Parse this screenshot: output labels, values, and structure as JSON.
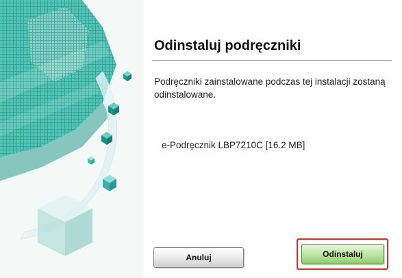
{
  "dialog": {
    "title": "Odinstaluj podręczniki",
    "description": "Podręczniki zainstalowane podczas tej instalacji zostaną odinstalowane.",
    "manual_item": "e-Podręcznik LBP7210C [16.2 MB]",
    "cancel_label": "Anuluj",
    "uninstall_label": "Odinstaluj"
  },
  "banner": {
    "image": "canon-cube-graphic"
  },
  "colors": {
    "highlight_border": "#e02a2a",
    "uninstall_button": "#a9dc87",
    "cancel_button": "#e2e2e2",
    "accent_teal": "#2aa59a"
  }
}
